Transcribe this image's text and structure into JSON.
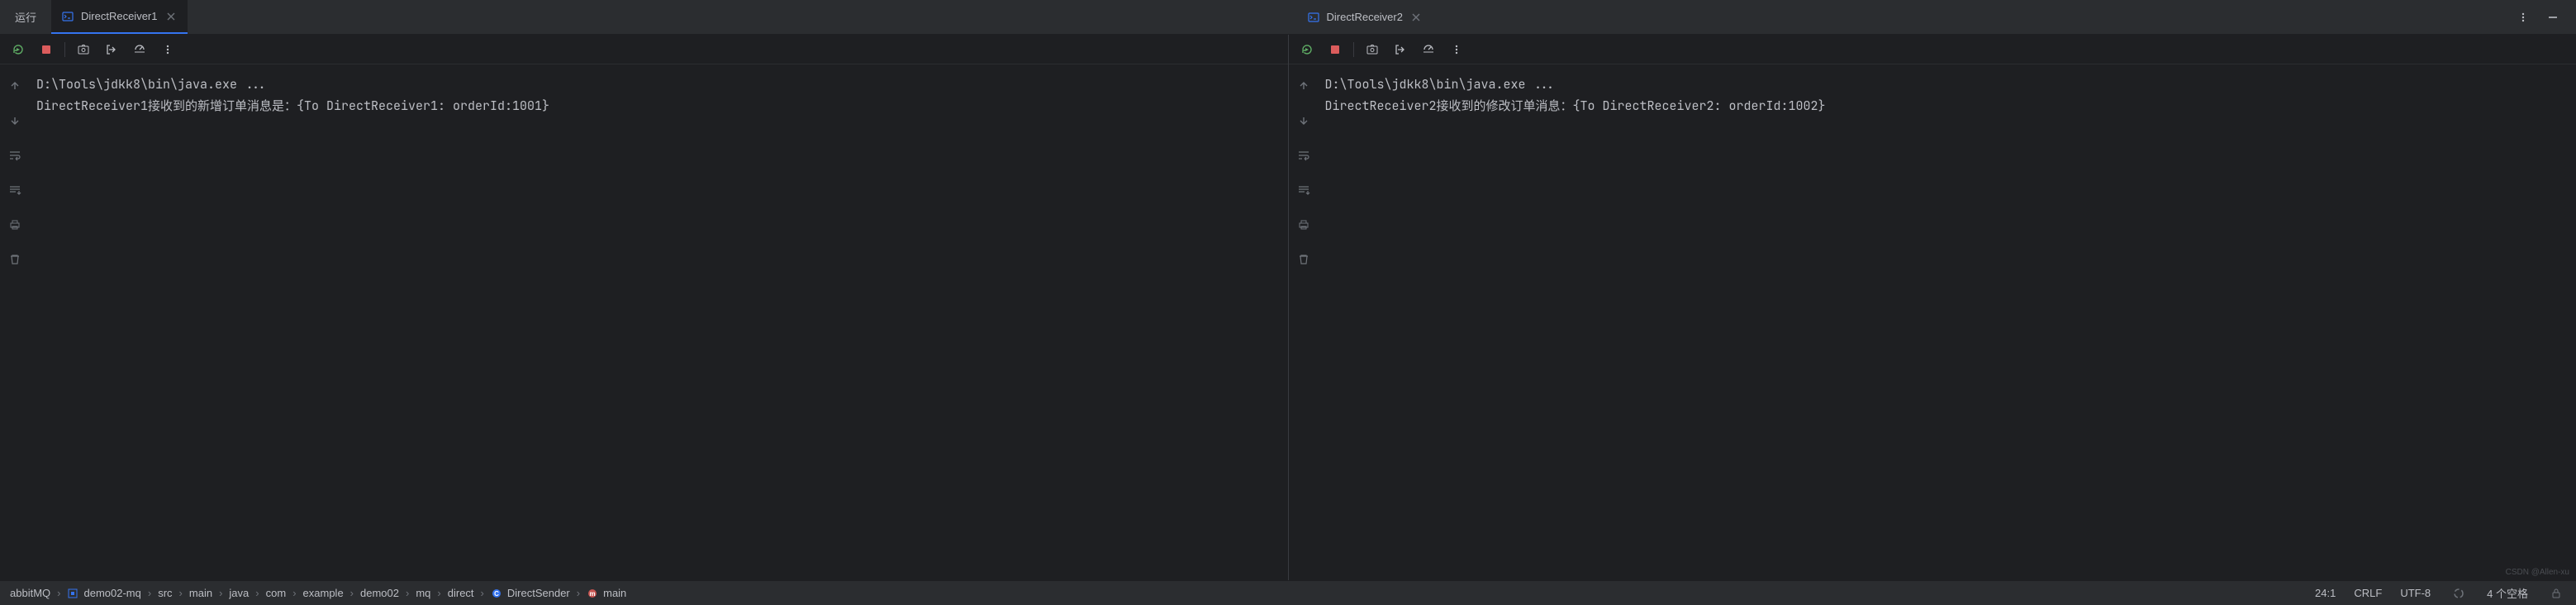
{
  "header": {
    "run_label": "运行",
    "tabs": [
      {
        "label": "DirectReceiver1",
        "active": true
      },
      {
        "label": "DirectReceiver2",
        "active": false
      }
    ]
  },
  "panes": [
    {
      "output_line1": "D:\\Tools\\jdkk8\\bin\\java.exe ...",
      "output_line2": "DirectReceiver1接收到的新增订单消息是：{To DirectReceiver1: orderId:1001}"
    },
    {
      "output_line1": "D:\\Tools\\jdkk8\\bin\\java.exe ...",
      "output_line2": "DirectReceiver2接收到的修改订单消息：{To DirectReceiver2: orderId:1002}"
    }
  ],
  "breadcrumb": {
    "root": "abbitMQ",
    "items": [
      "demo02-mq",
      "src",
      "main",
      "java",
      "com",
      "example",
      "demo02",
      "mq",
      "direct",
      "DirectSender",
      "main"
    ],
    "project_icon_color": "#3574f0",
    "class_icon_color": "#3574f0",
    "method_icon_color": "#c75450"
  },
  "status": {
    "position": "24:1",
    "line_sep": "CRLF",
    "encoding": "UTF-8",
    "indent": "4 个空格"
  },
  "watermark": "CSDN @Allen-xu",
  "colors": {
    "accent": "#3574f0",
    "green": "#5fad65",
    "red": "#db5c5c"
  },
  "icons": {
    "console_tab": "console-icon",
    "close": "close-icon",
    "rerun": "rerun-icon",
    "stop": "stop-icon",
    "camera": "camera-icon",
    "exit": "exit-icon",
    "profile": "profile-icon",
    "more": "more-vert-icon",
    "minimize": "minimize-icon",
    "up": "arrow-up-icon",
    "down": "arrow-down-icon",
    "wrap": "soft-wrap-icon",
    "scroll": "scroll-to-end-icon",
    "print": "print-icon",
    "trash": "trash-icon",
    "loading": "loading-spinner-icon",
    "lock": "lock-icon"
  }
}
